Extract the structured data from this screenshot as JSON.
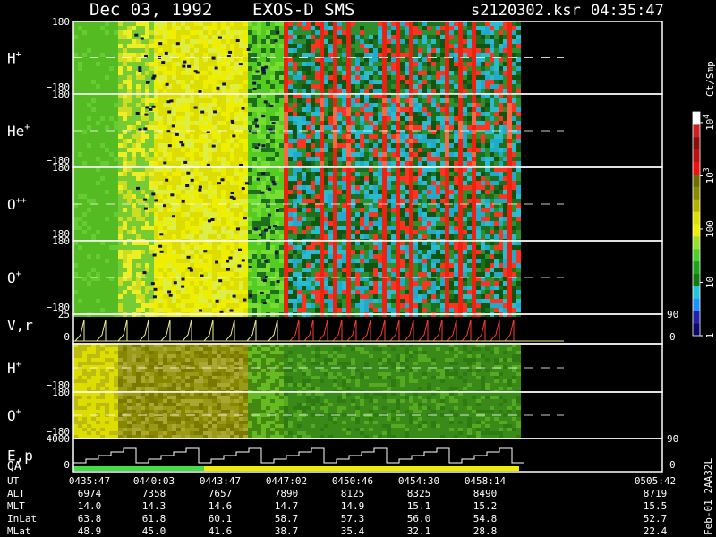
{
  "chart_data": {
    "type": "heatmap",
    "header": {
      "date": "Dec 03, 1992",
      "instrument": "EXOS-D SMS",
      "file": "s2120302.ksr",
      "time": "04:35:47"
    },
    "panels": [
      {
        "label": "H",
        "sup": "+",
        "ymax": "180",
        "ymin": "−180",
        "style": "pitch"
      },
      {
        "label": "He",
        "sup": "+",
        "ymax": "180",
        "ymin": "−180",
        "style": "pitch"
      },
      {
        "label": "O",
        "sup": "++",
        "ymax": "180",
        "ymin": "−180",
        "style": "pitch"
      },
      {
        "label": "O",
        "sup": "+",
        "ymax": "180",
        "ymin": "−180",
        "style": "pitch"
      },
      {
        "label": "V,r",
        "sup": "",
        "ymax": "25",
        "ymin": "0",
        "style": "line",
        "right_top": "90",
        "right_bottom": "0"
      },
      {
        "label": "H",
        "sup": "+",
        "ymax": "",
        "ymin": "−180",
        "style": "olive"
      },
      {
        "label": "O",
        "sup": "+",
        "ymax": "180",
        "ymin": "−180",
        "style": "olive"
      },
      {
        "label": "E,p",
        "label2": "QA",
        "ymax": "4000",
        "ymin": "0",
        "style": "step",
        "right_top": "90",
        "right_bottom": "0"
      }
    ],
    "colorbar": {
      "unit": "Ct/Smp",
      "ticks": [
        {
          "value": 1,
          "label": "1"
        },
        {
          "value": 10,
          "label": "10"
        },
        {
          "value": 100,
          "label": "100"
        },
        {
          "value": 1000,
          "label": "10",
          "sup": "3"
        },
        {
          "value": 10000,
          "label": "10",
          "sup": "4"
        }
      ]
    },
    "ephemeris": {
      "rows": [
        {
          "name": "UT",
          "values": [
            "0435:47",
            "0440:03",
            "0443:47",
            "0447:02",
            "0450:46",
            "0454:30",
            "0458:14",
            "0505:42"
          ]
        },
        {
          "name": "ALT",
          "values": [
            "6974",
            "7358",
            "7657",
            "7890",
            "8125",
            "8325",
            "8490",
            "8719"
          ]
        },
        {
          "name": "MLT",
          "values": [
            "14.0",
            "14.3",
            "14.6",
            "14.7",
            "14.9",
            "15.1",
            "15.2",
            "15.5"
          ]
        },
        {
          "name": "InLat",
          "values": [
            "63.8",
            "61.8",
            "60.1",
            "58.7",
            "57.3",
            "56.0",
            "54.8",
            "52.7"
          ]
        },
        {
          "name": "MLat",
          "values": [
            "48.9",
            "45.0",
            "41.6",
            "38.7",
            "35.4",
            "32.1",
            "28.8",
            "22.4"
          ]
        }
      ]
    },
    "side_label": "Feb-01 2AA32L",
    "colors": {
      "background": "#000000",
      "frame": "#ffffff",
      "qa_green": "#44dd44",
      "qa_yellow": "#eeee00",
      "vr_line_early": "#eeee88",
      "vr_line_late": "#ff3b2e"
    }
  }
}
